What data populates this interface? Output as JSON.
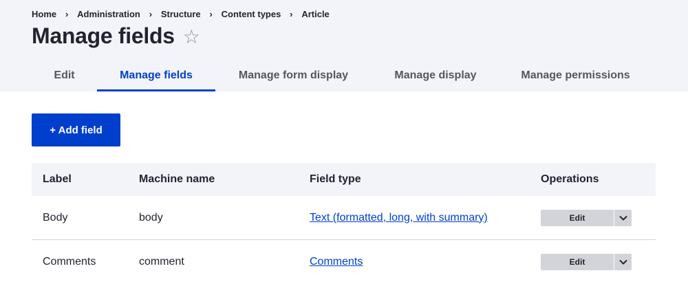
{
  "breadcrumb": [
    "Home",
    "Administration",
    "Structure",
    "Content types",
    "Article"
  ],
  "breadcrumb_separator": "›",
  "page_title": "Manage fields",
  "favorite_icon": "star-outline-icon",
  "tabs": [
    {
      "label": "Edit",
      "active": false
    },
    {
      "label": "Manage fields",
      "active": true
    },
    {
      "label": "Manage form display",
      "active": false
    },
    {
      "label": "Manage display",
      "active": false
    },
    {
      "label": "Manage permissions",
      "active": false
    }
  ],
  "add_field_label": "+ Add field",
  "table": {
    "headers": {
      "label": "Label",
      "machine_name": "Machine name",
      "field_type": "Field type",
      "operations": "Operations"
    },
    "rows": [
      {
        "label": "Body",
        "machine_name": "body",
        "field_type": "Text (formatted, long, with summary)",
        "operation": "Edit"
      },
      {
        "label": "Comments",
        "machine_name": "comment",
        "field_type": "Comments",
        "operation": "Edit"
      }
    ]
  },
  "colors": {
    "accent": "#003ecc",
    "header_bg": "#f3f4f9",
    "button_gray": "#d3d4d9"
  }
}
